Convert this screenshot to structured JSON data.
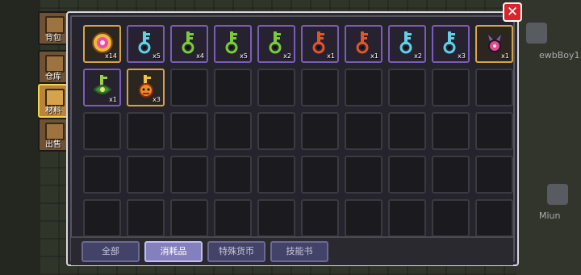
{
  "side_tabs": [
    {
      "label": "背包",
      "active": false,
      "icon": "backpack-icon"
    },
    {
      "label": "仓库",
      "active": false,
      "icon": "warehouse-icon"
    },
    {
      "label": "材料",
      "active": true,
      "icon": "materials-icon"
    },
    {
      "label": "出售",
      "active": false,
      "icon": "sell-icon"
    }
  ],
  "close_label": "✕",
  "items": [
    {
      "icon": "gold-coin-icon",
      "color": "#e94fa8",
      "qty": "x14",
      "frame": "gold"
    },
    {
      "icon": "cyan-key-icon",
      "color": "#5fd0e6",
      "qty": "x5",
      "frame": "item"
    },
    {
      "icon": "green-key-icon",
      "color": "#7acb3a",
      "qty": "x4",
      "frame": "item"
    },
    {
      "icon": "green-key-icon",
      "color": "#7acb3a",
      "qty": "x5",
      "frame": "item"
    },
    {
      "icon": "green-key-icon",
      "color": "#7acb3a",
      "qty": "x2",
      "frame": "item"
    },
    {
      "icon": "red-key-icon",
      "color": "#e2542a",
      "qty": "x1",
      "frame": "item"
    },
    {
      "icon": "red-key-icon",
      "color": "#e2542a",
      "qty": "x1",
      "frame": "item"
    },
    {
      "icon": "cyan-key-icon",
      "color": "#5fd0e6",
      "qty": "x2",
      "frame": "item"
    },
    {
      "icon": "cyan-key-icon",
      "color": "#5fd0e6",
      "qty": "x3",
      "frame": "item"
    },
    {
      "icon": "pink-claw-key-icon",
      "color": "#d94f8f",
      "qty": "x1",
      "frame": "gold"
    },
    {
      "icon": "green-ornate-key-icon",
      "color": "#9fcf4a",
      "qty": "x1",
      "frame": "item"
    },
    {
      "icon": "flame-demon-key-icon",
      "color": "#f08a24",
      "qty": "x3",
      "frame": "gold"
    }
  ],
  "bottom_tabs": [
    {
      "label": "全部",
      "active": false
    },
    {
      "label": "消耗品",
      "active": true
    },
    {
      "label": "特殊货币",
      "active": false
    },
    {
      "label": "技能书",
      "active": false
    }
  ],
  "background_labels": {
    "player_name_1": "ewbBoy1",
    "player_name_2": "Miun"
  }
}
